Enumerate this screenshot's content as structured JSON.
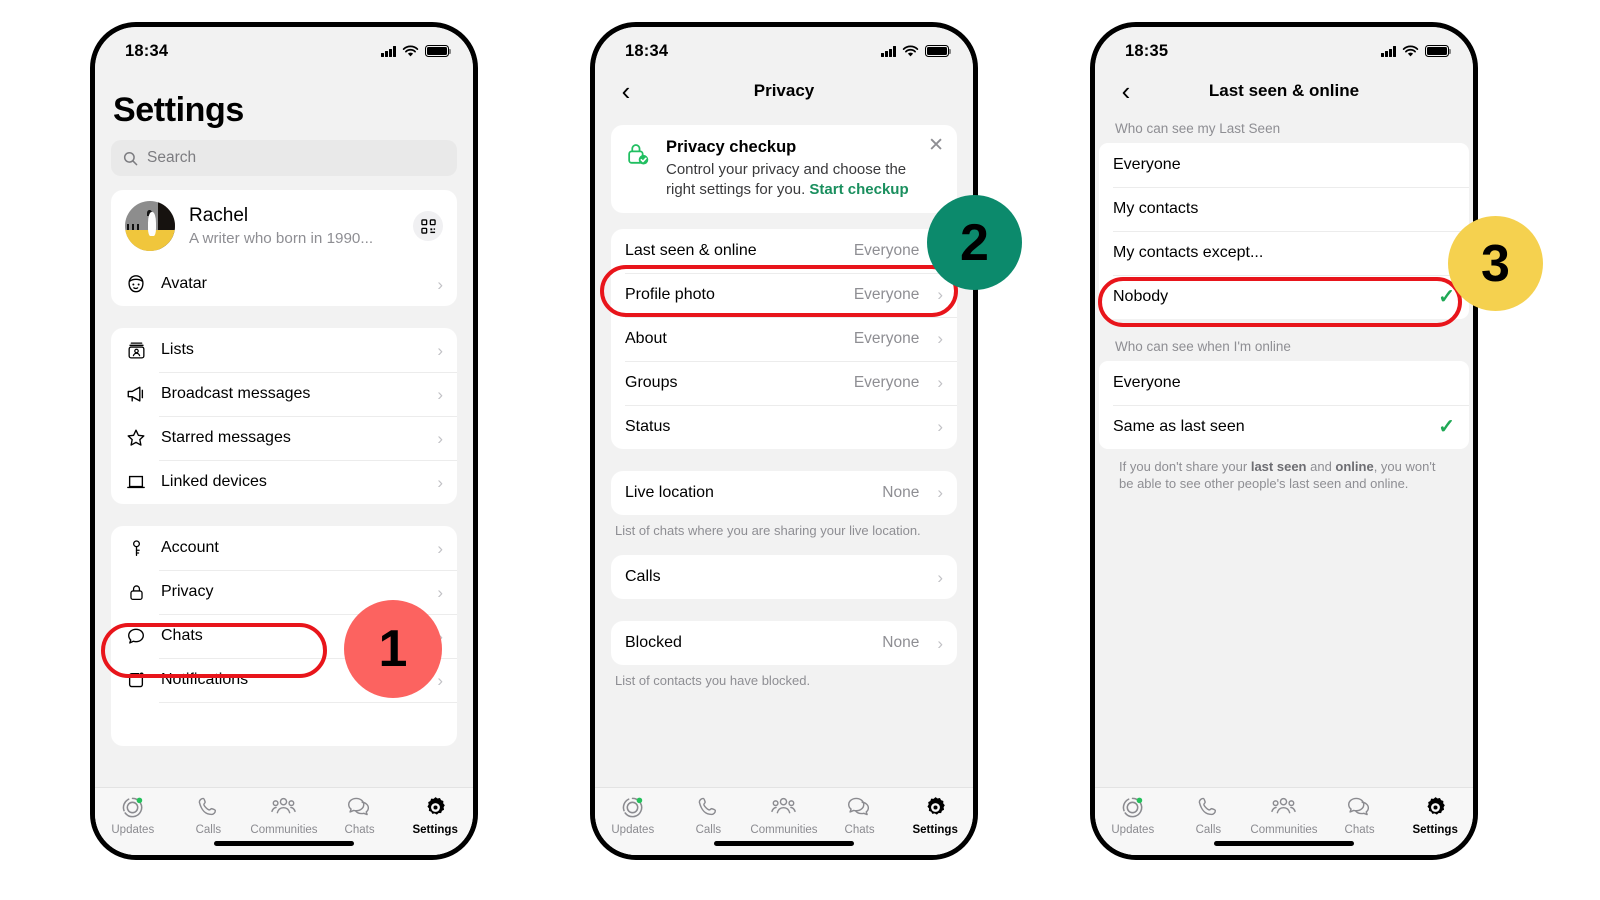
{
  "phones": [
    {
      "id": "settings",
      "status": {
        "time": "18:34",
        "signal_icon": "signal-bars-icon",
        "wifi_icon": "wifi-icon",
        "battery_icon": "battery-full-icon"
      },
      "title": "Settings",
      "search": {
        "placeholder": "Search",
        "icon": "search-icon"
      },
      "profile": {
        "name": "Rachel",
        "about": "A writer who born in 1990...",
        "qr_icon": "qr-code-icon",
        "avatar_icon": "avatar-photo"
      },
      "avatar_row": {
        "label": "Avatar",
        "icon": "avatar-face-icon"
      },
      "group_tools": [
        {
          "label": "Lists",
          "icon": "lists-icon"
        },
        {
          "label": "Broadcast messages",
          "icon": "megaphone-icon"
        },
        {
          "label": "Starred messages",
          "icon": "star-icon"
        },
        {
          "label": "Linked devices",
          "icon": "laptop-icon"
        }
      ],
      "group_account": [
        {
          "label": "Account",
          "icon": "key-icon"
        },
        {
          "label": "Privacy",
          "icon": "lock-icon"
        },
        {
          "label": "Chats",
          "icon": "chat-bubble-icon"
        },
        {
          "label": "Notifications",
          "icon": "notification-icon"
        }
      ]
    },
    {
      "id": "privacy",
      "status": {
        "time": "18:34"
      },
      "nav": {
        "back_icon": "back-chevron-icon",
        "title": "Privacy"
      },
      "checkup": {
        "icon": "lock-check-icon",
        "heading": "Privacy checkup",
        "body": "Control your privacy and choose the right settings for you.",
        "link": "Start checkup",
        "close_icon": "close-icon"
      },
      "group_who": [
        {
          "label": "Last seen & online",
          "value": "Everyone"
        },
        {
          "label": "Profile photo",
          "value": "Everyone"
        },
        {
          "label": "About",
          "value": "Everyone"
        },
        {
          "label": "Groups",
          "value": "Everyone"
        },
        {
          "label": "Status",
          "value": ""
        }
      ],
      "live_location": {
        "label": "Live location",
        "value": "None"
      },
      "live_location_note": "List of chats where you are sharing your live location.",
      "calls": {
        "label": "Calls",
        "value": ""
      },
      "blocked": {
        "label": "Blocked",
        "value": "None"
      },
      "blocked_note": "List of contacts you have blocked."
    },
    {
      "id": "lastseen",
      "status": {
        "time": "18:35"
      },
      "nav": {
        "back_icon": "back-chevron-icon",
        "title": "Last seen & online"
      },
      "section1_header": "Who can see my Last Seen",
      "section1_options": [
        {
          "label": "Everyone",
          "selected": false,
          "chevron": false
        },
        {
          "label": "My contacts",
          "selected": false,
          "chevron": false
        },
        {
          "label": "My contacts except...",
          "selected": false,
          "chevron": true
        },
        {
          "label": "Nobody",
          "selected": true,
          "chevron": false
        }
      ],
      "section2_header": "Who can see when I'm online",
      "section2_options": [
        {
          "label": "Everyone",
          "selected": false,
          "chevron": false
        },
        {
          "label": "Same as last seen",
          "selected": true,
          "chevron": false
        }
      ],
      "note_parts": {
        "p1": "If you don't share your ",
        "b1": "last seen",
        "p2": " and ",
        "b2": "online",
        "p3": ", you won't be able to see other people's last seen and online."
      }
    }
  ],
  "tabbar": {
    "tabs": [
      {
        "label": "Updates",
        "icon": "updates-ring-icon",
        "active": false,
        "dot": true
      },
      {
        "label": "Calls",
        "icon": "phone-icon",
        "active": false,
        "dot": false
      },
      {
        "label": "Communities",
        "icon": "communities-icon",
        "active": false,
        "dot": false
      },
      {
        "label": "Chats",
        "icon": "chats-icon",
        "active": false,
        "dot": false
      },
      {
        "label": "Settings",
        "icon": "gear-icon",
        "active": true,
        "dot": false
      }
    ]
  },
  "badges": [
    {
      "number": "1",
      "color": "#fc6360"
    },
    {
      "number": "2",
      "color": "#0c8a6c"
    },
    {
      "number": "3",
      "color": "#f5d14f"
    }
  ],
  "colors": {
    "highlight_outline": "#e8151b",
    "accent_green": "#1fa855",
    "link_green": "#1a8f5e",
    "page_bg": "#f2f2f2",
    "card_bg": "#ffffff",
    "secondary_text": "#8e8e93"
  }
}
